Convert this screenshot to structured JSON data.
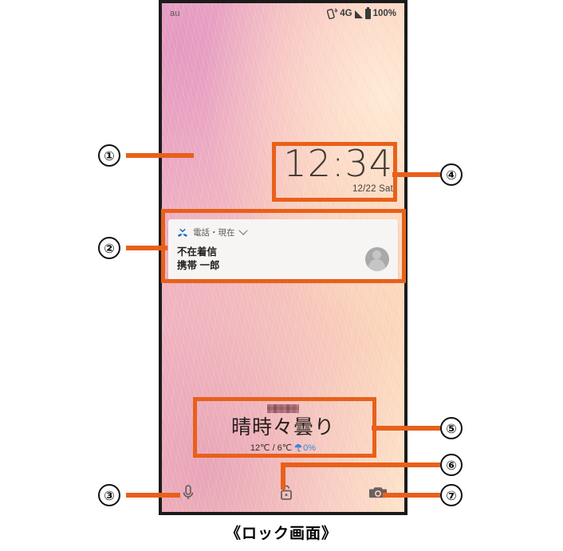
{
  "caption": "《ロック画面》",
  "phone": {
    "status_bar": {
      "carrier": "au",
      "vibrate_icon": "vibrate-icon",
      "network": "4G",
      "signal_icon": "signal-bars-icon",
      "battery_icon": "battery-full-icon",
      "battery_percent": "100%"
    },
    "clock": {
      "time": "12:34",
      "date": "12/22 Sat"
    },
    "notification": {
      "app_icon": "missed-call-icon",
      "app_label": "電話・現在",
      "expand_icon": "chevron-down-icon",
      "title": "不在着信",
      "subtitle": "携帯 一郎",
      "avatar_icon": "contact-avatar-icon"
    },
    "weather": {
      "location": "",
      "condition": "晴時々曇り",
      "temps": "12℃ / 6℃",
      "rain_icon": "umbrella-icon",
      "rain_chance": "0%"
    },
    "shortcuts": {
      "mic": "microphone-icon",
      "lock": "unlocked-padlock-icon",
      "camera": "camera-icon"
    }
  },
  "callouts": [
    {
      "number": "①",
      "target": "wallpaper"
    },
    {
      "number": "②",
      "target": "notification"
    },
    {
      "number": "③",
      "target": "microphone"
    },
    {
      "number": "④",
      "target": "clock"
    },
    {
      "number": "⑤",
      "target": "weather"
    },
    {
      "number": "⑥",
      "target": "lock"
    },
    {
      "number": "⑦",
      "target": "camera"
    }
  ],
  "colors": {
    "accent": "#e8601a",
    "marker_border": "#111111",
    "link_blue": "#3f86d8"
  }
}
